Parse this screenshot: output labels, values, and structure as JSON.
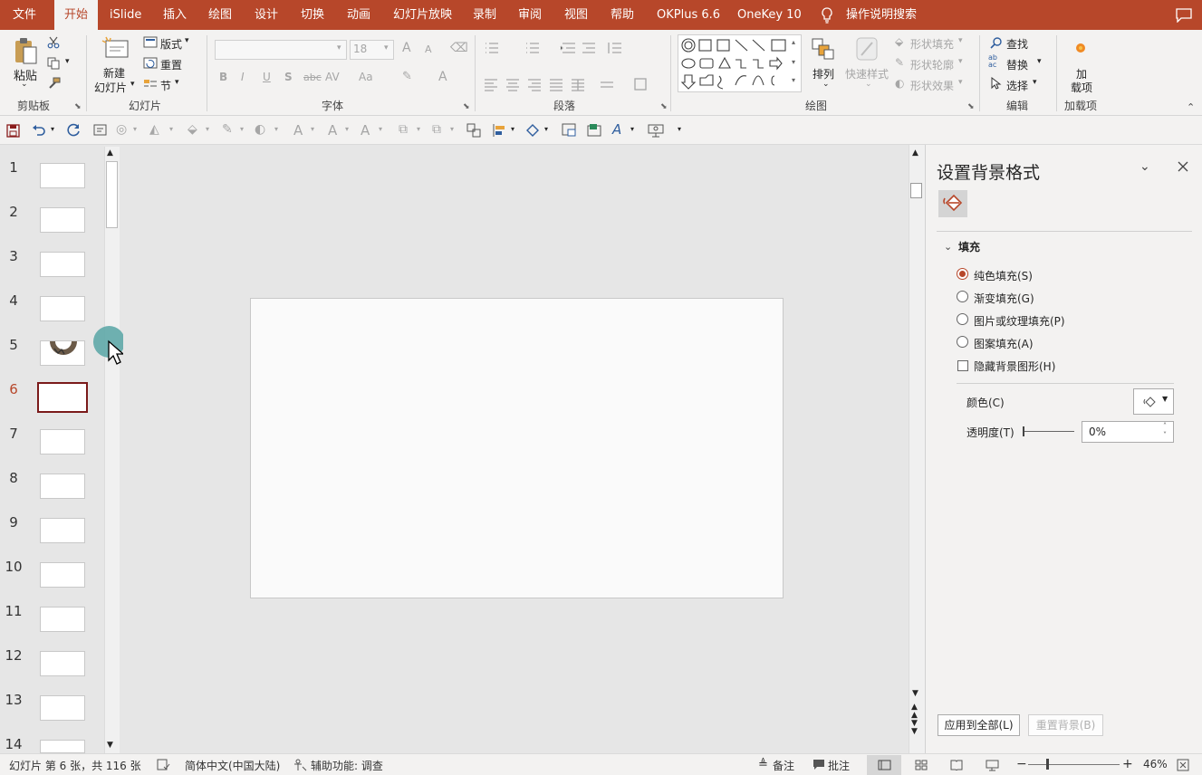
{
  "menu_tabs": [
    "文件",
    "开始",
    "iSlide",
    "插入",
    "绘图",
    "设计",
    "切换",
    "动画",
    "幻灯片放映",
    "录制",
    "审阅",
    "视图",
    "帮助",
    "OKPlus 6.6",
    "OneKey 10",
    "操作说明搜索"
  ],
  "ribbon": {
    "clipboard": {
      "paste": "粘贴",
      "group": "剪贴板"
    },
    "slides": {
      "new_slide_l1": "新建",
      "new_slide_l2": "幻灯片",
      "layout": "版式",
      "reset": "重置",
      "section": "节",
      "group": "幻灯片"
    },
    "font": {
      "size": "18",
      "group": "字体",
      "bold": "B",
      "italic": "I",
      "underline": "U",
      "strike": "S",
      "abc": "abc",
      "av": "AV",
      "aa": "Aa",
      "grow": "A",
      "shrink": "A",
      "color": "A"
    },
    "paragraph": {
      "group": "段落"
    },
    "drawing": {
      "arrange": "排列",
      "quick_styles": "快速样式",
      "shape_fill": "形状填充",
      "shape_outline": "形状轮廓",
      "shape_effects": "形状效果",
      "group": "绘图"
    },
    "editing": {
      "find": "查找",
      "replace": "替换",
      "select": "选择",
      "group": "编辑"
    },
    "addins": {
      "l1": "加",
      "l2": "载项",
      "group": "加载项"
    }
  },
  "thumbnails": [
    "1",
    "2",
    "3",
    "4",
    "5",
    "6",
    "7",
    "8",
    "9",
    "10",
    "11",
    "12",
    "13",
    "14"
  ],
  "selected_slide": "6",
  "format_pane": {
    "title": "设置背景格式",
    "section": "填充",
    "options": [
      "纯色填充(S)",
      "渐变填充(G)",
      "图片或纹理填充(P)",
      "图案填充(A)"
    ],
    "hide_bg": "隐藏背景图形(H)",
    "color_label": "颜色(C)",
    "transparency_label": "透明度(T)",
    "transparency_value": "0%",
    "apply_all": "应用到全部(L)",
    "reset_bg": "重置背景(B)"
  },
  "status": {
    "slide_info": "幻灯片 第 6 张，共 116 张",
    "language": "简体中文(中国大陆)",
    "accessibility": "辅助功能: 调查",
    "notes": "备注",
    "comments": "批注",
    "zoom": "46%"
  },
  "colors": {
    "accent": "#b7472a",
    "selected_border": "#7a1a1a",
    "cursor_circle": "#5fa8a8"
  }
}
